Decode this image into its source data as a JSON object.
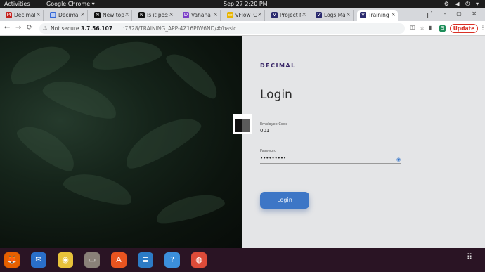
{
  "topbar": {
    "activities": "Activities",
    "app_name": "Google Chrome ▾",
    "clock": "Sep 27  2:20 PM",
    "system_icons": "⚙ ◀ ⏻ ▾"
  },
  "tabs": [
    {
      "icon": "M",
      "icon_color": "#c5221f",
      "title": "Decimal I"
    },
    {
      "icon": "▦",
      "icon_color": "#3367d6",
      "title": "Decimal"
    },
    {
      "icon": "N",
      "icon_color": "#111111",
      "title": "New top"
    },
    {
      "icon": "N",
      "icon_color": "#111111",
      "title": "Is it poss"
    },
    {
      "icon": "D",
      "icon_color": "#7b3fc7",
      "title": "Vahana E"
    },
    {
      "icon": "▭",
      "icon_color": "#e8b400",
      "title": "vFlow_C"
    },
    {
      "icon": "V",
      "icon_color": "#2a2a6e",
      "title": "Project M"
    },
    {
      "icon": "V",
      "icon_color": "#2a2a6e",
      "title": "Logs Ma"
    },
    {
      "icon": "V",
      "icon_color": "#2a2a6e",
      "title": "Training"
    }
  ],
  "tabstrip": {
    "new_tab": "+",
    "window_controls": "˅ – ▢ ✕"
  },
  "addressbar": {
    "back": "←",
    "forward": "→",
    "reload": "⟳",
    "lock": "⚠",
    "not_secure": "Not secure",
    "host": "3.7.56.107",
    "path": ":7328/TRAINING_APP-4Z16PIW6ND/#/basic",
    "key_icon": "⚿",
    "star_icon": "☆",
    "sidebar_icon": "▮",
    "avatar_letter": "S",
    "update_label": "Update",
    "menu_icon": "⋮"
  },
  "login": {
    "logo": "DECIMAL",
    "title": "Login",
    "employee_code_label": "Employee Code",
    "employee_code_value": "001",
    "password_label": "Password",
    "password_value": "•••••••••",
    "eye_icon": "◉",
    "button": "Login"
  },
  "dock": {
    "apps_grid": "⠿",
    "icons": [
      {
        "name": "firefox",
        "glyph": "🦊",
        "bg": "#e66000"
      },
      {
        "name": "thunderbird",
        "glyph": "✉",
        "bg": "#2a6fc9"
      },
      {
        "name": "rhythmbox",
        "glyph": "◉",
        "bg": "#e8c23a"
      },
      {
        "name": "files",
        "glyph": "▭",
        "bg": "#8a8178"
      },
      {
        "name": "software",
        "glyph": "A",
        "bg": "#e95420"
      },
      {
        "name": "writer",
        "glyph": "≣",
        "bg": "#2c7bc6"
      },
      {
        "name": "help",
        "glyph": "?",
        "bg": "#3c8fdc"
      },
      {
        "name": "chrome",
        "glyph": "◍",
        "bg": "#dd4b39"
      }
    ]
  }
}
